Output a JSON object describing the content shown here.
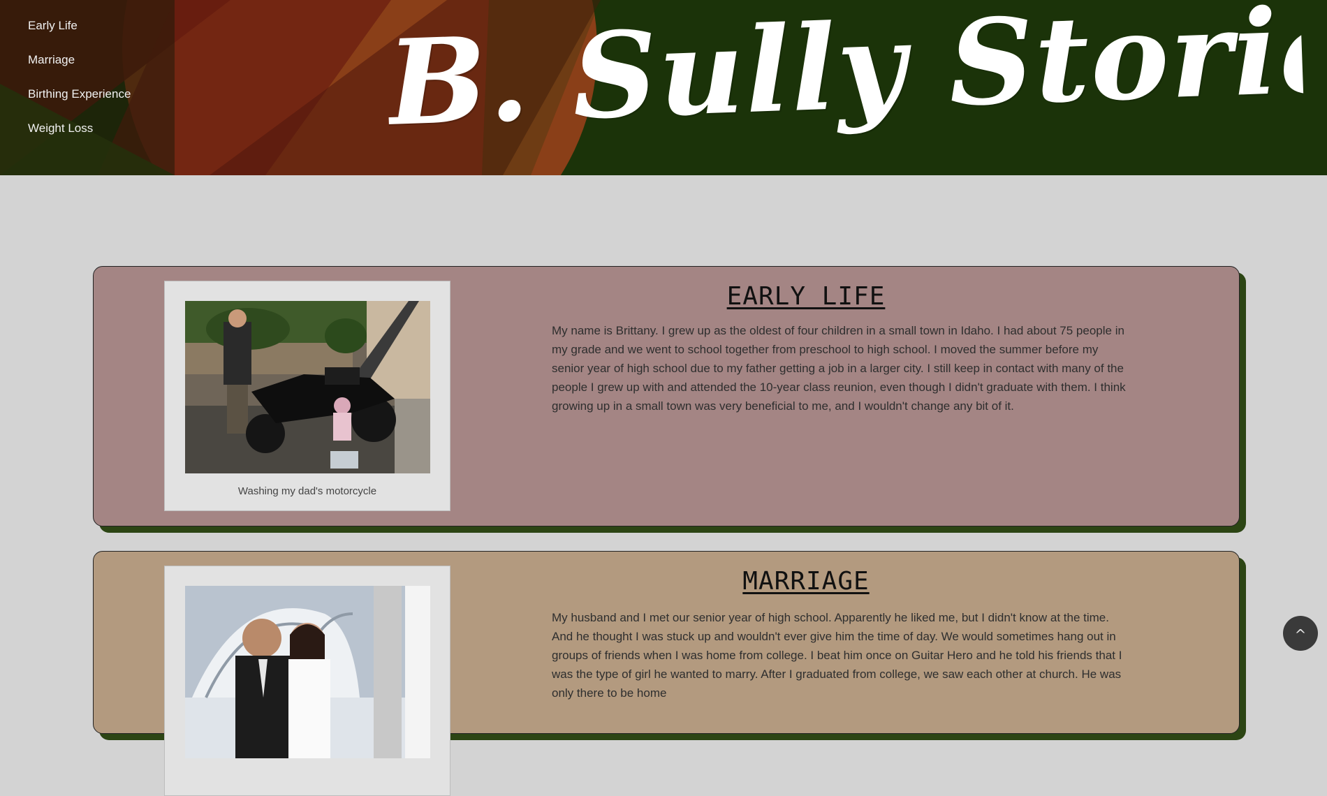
{
  "site": {
    "title": "B. Sully Stories"
  },
  "nav": {
    "items": [
      {
        "label": "Early Life"
      },
      {
        "label": "Marriage"
      },
      {
        "label": "Birthing Experience"
      },
      {
        "label": "Weight Loss"
      }
    ]
  },
  "stories": [
    {
      "title": "EARLY LIFE",
      "caption": "Washing my dad's motorcycle",
      "text": "My name is Brittany. I grew up as the oldest of four children in a small town in Idaho. I had about 75 people in my grade and we went to school together from preschool to high school. I moved the summer before my senior year of high school due to my father getting a job in a larger city. I still keep in contact with many of the people I grew up with and attended the 10-year class reunion, even though I didn't graduate with them. I think growing up in a small town was very beneficial to me, and I wouldn't change any bit of it."
    },
    {
      "title": "MARRIAGE",
      "caption": "",
      "text": "My husband and I met our senior year of high school. Apparently he liked me, but I didn't know at the time. And he thought I was stuck up and wouldn't ever give him the time of day. We would sometimes hang out in groups of friends when I was home from college. I beat him once on Guitar Hero and he told his friends that I was the type of girl he wanted to marry. After I graduated from college, we saw each other at church. He was only there to be home"
    }
  ],
  "back_to_top": {
    "label": "^"
  },
  "colors": {
    "banner_green": "#1b3309",
    "card_early_life": "#a48584",
    "card_marriage": "#b39a7f",
    "page_background": "#d3d3d3"
  }
}
